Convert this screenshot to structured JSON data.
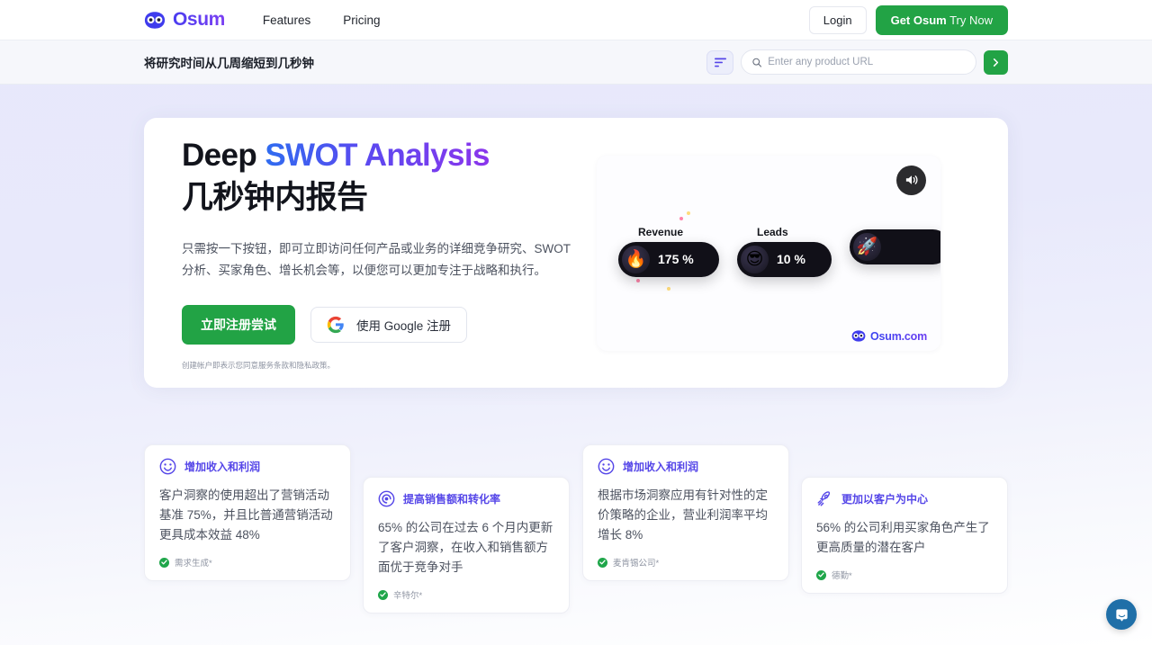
{
  "nav": {
    "brand": "Osum",
    "brand_icon": "owl-logo-icon",
    "links": [
      {
        "label": "Features"
      },
      {
        "label": "Pricing"
      }
    ],
    "login_label": "Login",
    "cta_bold": "Get Osum",
    "cta_light": "Try Now",
    "cta_color": "#22a345",
    "brand_color": "#5546e8"
  },
  "subbar": {
    "title": "将研究时间从几周缩短到几秒钟",
    "filter_icon": "filter-lines-icon",
    "search_icon": "search-icon",
    "search_placeholder": "Enter any product URL",
    "search_value": "",
    "go_icon": "chevron-right-icon",
    "go_color": "#22a345"
  },
  "hero": {
    "heading_part1": "Deep ",
    "heading_part2": "SWOT Analysis",
    "heading_line2": "几秒钟内报告",
    "paragraph": "只需按一下按钮，即可立即访问任何产品或业务的详细竞争研究、SWOT 分析、买家角色、增长机会等，以便您可以更加专注于战略和执行。",
    "signup_label": "立即注册尝试",
    "google_label": "使用 Google 注册",
    "google_icon": "google-g-icon",
    "disclaimer": "创建帐户即表示您同意服务条款和隐私政策。",
    "gradient_start": "#2f6cf0",
    "gradient_end": "#8b35ec"
  },
  "video": {
    "speaker_icon": "speaker-volume-icon",
    "watermark_text": "Osum.com",
    "watermark_icon": "owl-logo-icon",
    "pills": [
      {
        "label": "Revenue",
        "value": "175 %",
        "emoji": "🔥",
        "emoji_name": "fire-emoji"
      },
      {
        "label": "Leads",
        "value": "10 %",
        "emoji": "😎",
        "emoji_name": "cool-face-emoji"
      },
      {
        "label": "",
        "value": "",
        "emoji": "🚀",
        "emoji_name": "rocket-emoji"
      }
    ]
  },
  "cards": [
    {
      "icon": "smiley-face-icon",
      "title": "增加收入和利润",
      "body": "客户洞察的使用超出了营销活动基准 75%，并且比普通营销活动更具成本效益 48%",
      "source": "需求生成*"
    },
    {
      "icon": "target-spiral-icon",
      "title": "提高销售额和转化率",
      "body": "65% 的公司在过去 6 个月内更新了客户洞察，在收入和销售额方面优于竞争对手",
      "source": "辛特尔*"
    },
    {
      "icon": "smiley-face-icon",
      "title": "增加收入和利润",
      "body": "根据市场洞察应用有针对性的定价策略的企业，营业利润率平均增长 8%",
      "source": "麦肯锡公司*"
    },
    {
      "icon": "rocket-icon",
      "title": "更加以客户为中心",
      "body": "56% 的公司利用买家角色产生了更高质量的潜在客户",
      "source": "德勤*"
    }
  ],
  "chat": {
    "icon": "intercom-chat-icon",
    "color": "#1f6fa8"
  }
}
